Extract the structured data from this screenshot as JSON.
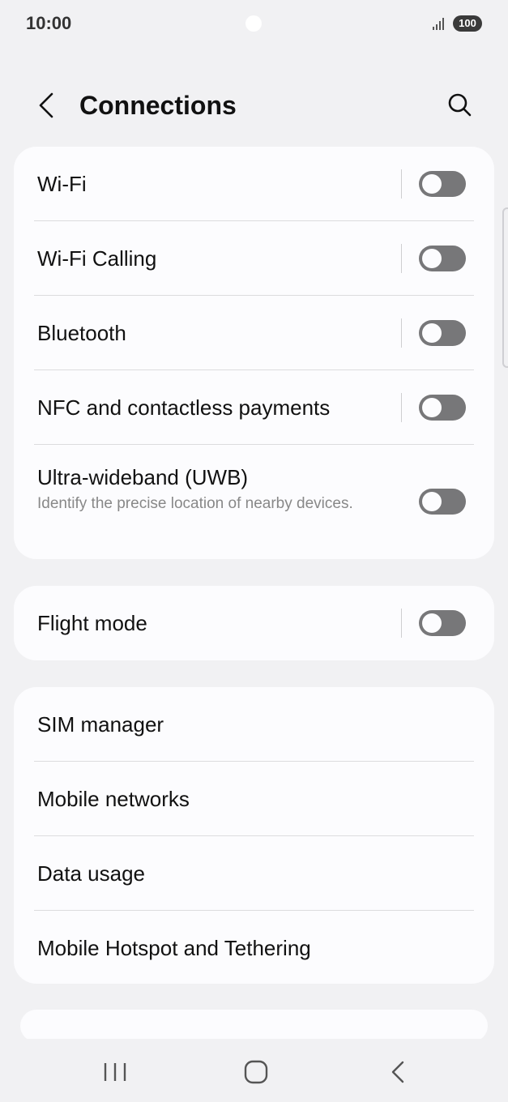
{
  "status_bar": {
    "time": "10:00",
    "battery": "100",
    "signal_icon": "signal-bars-icon"
  },
  "header": {
    "title": "Connections",
    "back_icon": "chevron-left-icon",
    "search_icon": "search-icon"
  },
  "card1": {
    "items": [
      {
        "label": "Wi-Fi",
        "toggle_on": false
      },
      {
        "label": "Wi-Fi Calling",
        "toggle_on": false
      },
      {
        "label": "Bluetooth",
        "toggle_on": false
      },
      {
        "label": "NFC and contactless payments",
        "toggle_on": false
      },
      {
        "label": "Ultra-wideband (UWB)",
        "sublabel": "Identify the precise location of nearby devices.",
        "toggle_on": false
      }
    ]
  },
  "card2": {
    "items": [
      {
        "label": "Flight mode",
        "toggle_on": false
      }
    ]
  },
  "card3": {
    "items": [
      {
        "label": "SIM manager"
      },
      {
        "label": "Mobile networks"
      },
      {
        "label": "Data usage"
      },
      {
        "label": "Mobile Hotspot and Tethering"
      }
    ]
  },
  "nav_bar": {
    "recents_icon": "recents-icon",
    "home_icon": "home-icon",
    "back_icon": "back-icon"
  },
  "colors": {
    "background": "#f1f1f3",
    "card": "#fcfcfe",
    "toggle_off": "#777779"
  }
}
